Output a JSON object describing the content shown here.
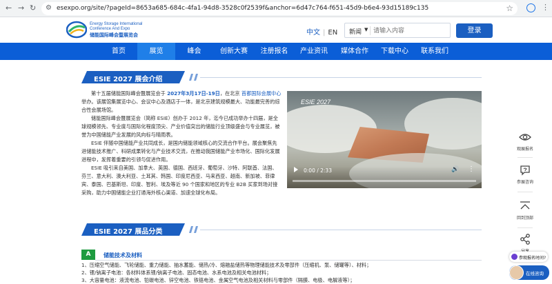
{
  "browser": {
    "url": "esexpo.org/site/?pageId=8653a685-684c-4fa1-94d8-3528c0f2539f&anchor=6d47c764-f651-45d9-b6e4-93d15189c135"
  },
  "header": {
    "logo_en": "Energy Storage International\nConference And Expo",
    "logo_cn": "储能国际峰会暨展览会",
    "lang_cn": "中文",
    "lang_sep": "|",
    "lang_en": "EN",
    "search_scope": "新闻",
    "search_placeholder": "请输入内容",
    "login_label": "登录"
  },
  "nav": {
    "items": [
      "首页",
      "展览",
      "峰会",
      "创新大赛",
      "注册报名",
      "产业资讯",
      "媒体合作",
      "下载中心",
      "联系我们"
    ],
    "active": "展览"
  },
  "intro_section": {
    "title": "ESIE 2027 展会介绍",
    "p1_a": "第十五届储能国际峰会暨展览会于 ",
    "p1_date": "2027年3月17日-19日",
    "p1_b": "，在北京 ",
    "p1_venue": "首都国际会展中心",
    "p1_c": " 举办。该展馆集展览中心、会议中心及酒店于一体，是北京建筑规模最大、功能最完善的综合性会展场馆。",
    "p2": "储能国际峰会暨展览会（简称 ESIE）创办于 2012 年，迄今已成功举办十四届，是全球规模领先、专业度与国际化程度顶尖、产业价值突出的储能行业顶级盛会与专业展览，被誉为中国储能产业发展的风向标与晴雨表。",
    "p3": "ESIE 伴随中国储能产业共同成长，是国内储能领域核心的交流合作平台。展会聚焦先进储能技术推广、科研成果转化与产业技术交流，在推动我国储能产业市场化、国际化发展进程中，发挥着重要的引领与促进作用。",
    "p4": "ESIE 吸引来自美国、加拿大、英国、德国、西班牙、葡萄牙、沙特、阿联酋、法国、芬兰、意大利、澳大利亚、土耳其、韩国、印度尼西亚、马来西亚、越南、新加坡、菲律宾、泰国、巴基斯坦、印度、智利、埃及等近 90 个国家和地区的专业 B2B 买家到场对接采购，助力中国储能企业打通海外核心渠道、加速全球化布局。"
  },
  "video": {
    "overlay_label": "ESIE 2027",
    "time": "0:00 / 2:33",
    "progress": 0
  },
  "category_section": {
    "title": "ESIE 2027 展品分类",
    "category_letter": "A",
    "category_name": "储能技术及材料",
    "items": [
      "1、压缩空气储能、飞轮储能、重力储能、抽水蓄能、储热/冷、熔融盐储热等物理储能技术及零部件（压缩机、泵、储罐等）、材料；",
      "2、锂/钠离子电池：各材料体系锂/钠离子电池、固态电池、水系电池及相关电池材料；",
      "3、大容量电池：液流电池、铅碳电池、锌空电池、铁铬电池、金属空气电池及相关材料与零部件（隔膜、电极、电解液等）；"
    ]
  },
  "sidebar": {
    "items": [
      {
        "label": "观展报名",
        "icon": "eye-icon"
      },
      {
        "label": "参展咨询",
        "icon": "chat-bubble-icon"
      },
      {
        "label": "回到顶部",
        "icon": "back-to-top-icon"
      },
      {
        "label": "分享",
        "icon": "share-icon"
      }
    ]
  },
  "floating": {
    "register_label": "参观报名时间?",
    "chat_label": "在线咨询"
  }
}
